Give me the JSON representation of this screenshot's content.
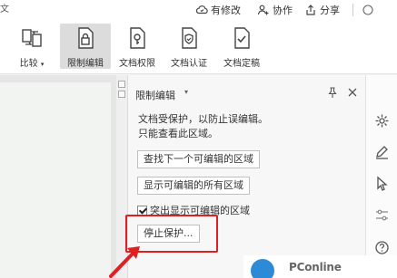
{
  "header": {
    "left_fragment": "文",
    "modify_label": "有修改",
    "collab_label": "协作",
    "share_label": "分享"
  },
  "ribbon": {
    "compare_label": "比较",
    "restrict_label": "限制编辑",
    "permission_label": "文档权限",
    "certify_label": "文档认证",
    "finalize_label": "文档定稿"
  },
  "panel": {
    "title": "限制编辑",
    "info_line1": "文档受保护，以防止误编辑。",
    "info_line2": "只能查看此区域。",
    "find_next_label": "查找下一个可编辑的区域",
    "show_all_label": "显示可编辑的所有区域",
    "highlight_label": "突出显示可编辑的区域",
    "highlight_checked": true,
    "stop_label": "停止保护..."
  },
  "watermark": {
    "brand": "PConline"
  },
  "colors": {
    "accent": "#2d8ad6",
    "annotation": "#e02020",
    "active_ribbon": "#dcdcdc"
  },
  "icons": [
    "cloud-sync-icon",
    "add-user-icon",
    "share-icon",
    "compare-icon",
    "lock-document-icon",
    "key-document-icon",
    "shield-document-icon",
    "check-document-icon",
    "pin-icon",
    "close-icon",
    "settings-icon",
    "pen-icon",
    "cursor-icon",
    "sliders-icon",
    "help-icon"
  ]
}
